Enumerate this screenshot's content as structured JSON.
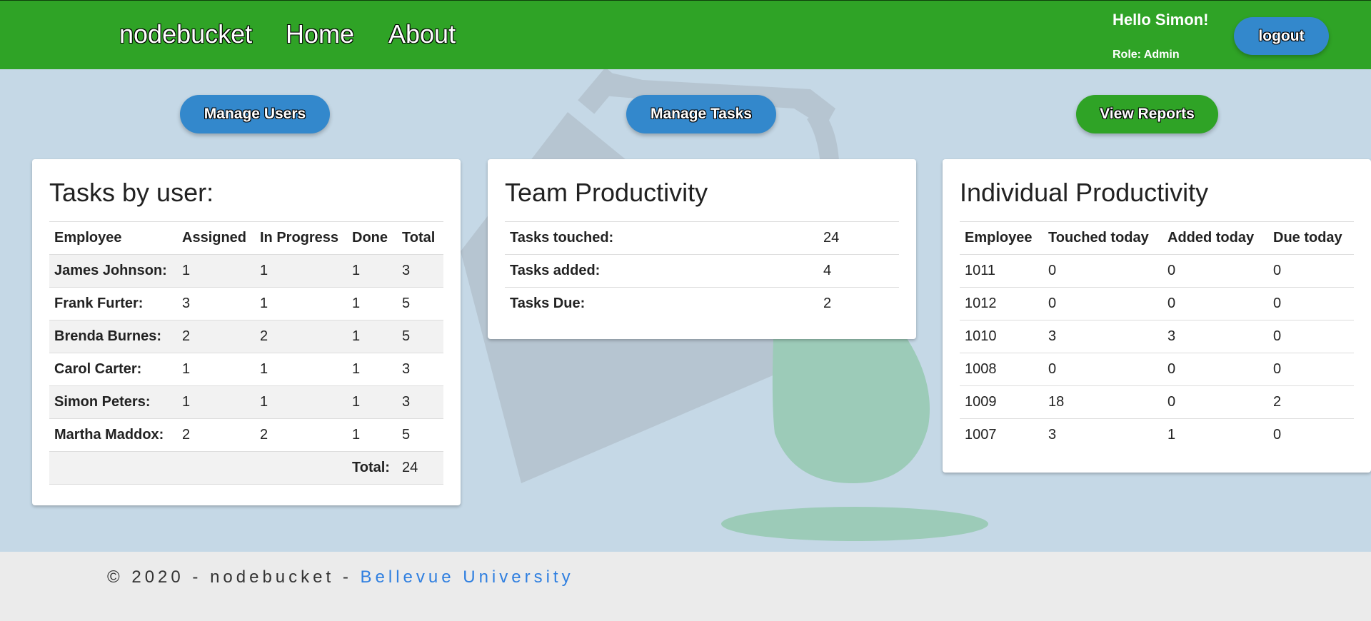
{
  "header": {
    "brand": "nodebucket",
    "nav": [
      {
        "label": "Home"
      },
      {
        "label": "About"
      }
    ],
    "greeting": "Hello Simon!",
    "role": "Role: Admin",
    "logout_label": "logout"
  },
  "actions": {
    "manage_users": "Manage Users",
    "manage_tasks": "Manage Tasks",
    "view_reports": "View Reports"
  },
  "tasks_by_user": {
    "title": "Tasks by user:",
    "columns": [
      "Employee",
      "Assigned",
      "In Progress",
      "Done",
      "Total"
    ],
    "rows": [
      [
        "James Johnson:",
        "1",
        "1",
        "1",
        "3"
      ],
      [
        "Frank Furter:",
        "3",
        "1",
        "1",
        "5"
      ],
      [
        "Brenda Burnes:",
        "2",
        "2",
        "1",
        "5"
      ],
      [
        "Carol Carter:",
        "1",
        "1",
        "1",
        "3"
      ],
      [
        "Simon Peters:",
        "1",
        "1",
        "1",
        "3"
      ],
      [
        "Martha Maddox:",
        "2",
        "2",
        "1",
        "5"
      ]
    ],
    "total_label": "Total:",
    "total_value": "24"
  },
  "team_productivity": {
    "title": "Team Productivity",
    "rows": [
      [
        "Tasks touched:",
        "24"
      ],
      [
        "Tasks added:",
        "4"
      ],
      [
        "Tasks Due:",
        "2"
      ]
    ]
  },
  "individual_productivity": {
    "title": "Individual Productivity",
    "columns": [
      "Employee",
      "Touched today",
      "Added today",
      "Due today"
    ],
    "rows": [
      [
        "1011",
        "0",
        "0",
        "0"
      ],
      [
        "1012",
        "0",
        "0",
        "0"
      ],
      [
        "1010",
        "3",
        "3",
        "0"
      ],
      [
        "1008",
        "0",
        "0",
        "0"
      ],
      [
        "1009",
        "18",
        "0",
        "2"
      ],
      [
        "1007",
        "3",
        "1",
        "0"
      ]
    ]
  },
  "footer": {
    "text": "© 2020 - nodebucket - ",
    "link": "Bellevue University"
  },
  "colors": {
    "header_green": "#2fa326",
    "button_blue": "#3388cc",
    "page_background": "#c5d8e6",
    "footer_link": "#2f7fe0"
  }
}
